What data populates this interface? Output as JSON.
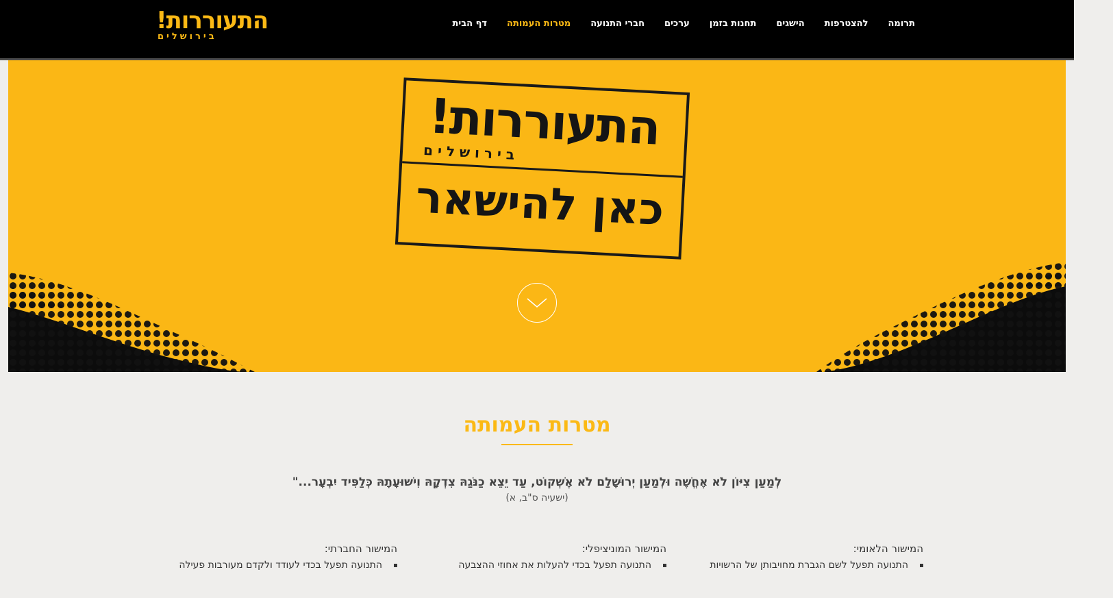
{
  "header": {
    "logo": {
      "main": "התעוררות!",
      "sub": "בירושלים"
    },
    "nav": [
      {
        "label": "דף הבית",
        "active": false
      },
      {
        "label": "מטרות העמותה",
        "active": true
      },
      {
        "label": "חברי התנועה",
        "active": false
      },
      {
        "label": "ערכים",
        "active": false
      },
      {
        "label": "תחנות בזמן",
        "active": false
      },
      {
        "label": "הישגים",
        "active": false
      },
      {
        "label": "להצטרפות",
        "active": false
      },
      {
        "label": "תרומה",
        "active": false
      }
    ]
  },
  "hero": {
    "stamp_title": "התעוררות!",
    "stamp_sub": "בירושלים",
    "stamp_slogan": "כאן להישאר",
    "scroll_icon": "chevron-down-icon"
  },
  "content": {
    "title": "מטרות העמותה",
    "verse": "לְמַעַן צִיּוֹן לֹא אֶחֱשֶׁה וּלְמַעַן יְרוּשָׁלִַם לֹא אֶשְׁקוֹט, עַד יֵצֵא כַנֹּגַהּ צִדְקָהּ וִישׁוּעָתָהּ כְּלַפִּיד יִבְעָר...\"",
    "verse_source": "(ישעיה ס\"ב, א)",
    "columns": [
      {
        "heading": "המישור הלאומי:",
        "items": [
          "התנועה תפעל לשם הגברת מחויבותן של הרשויות"
        ]
      },
      {
        "heading": "המישור המוניציפלי:",
        "items": [
          "התנועה תפעל בכדי להעלות את אחוזי ההצבעה"
        ]
      },
      {
        "heading": "המישור החברתי:",
        "items": [
          "התנועה תפעל בכדי לעודד ולקדם מעורבות פעילה"
        ]
      }
    ]
  },
  "colors": {
    "brand_yellow": "#fbb915",
    "header_bg": "#000000",
    "page_bg": "#efeeec"
  }
}
